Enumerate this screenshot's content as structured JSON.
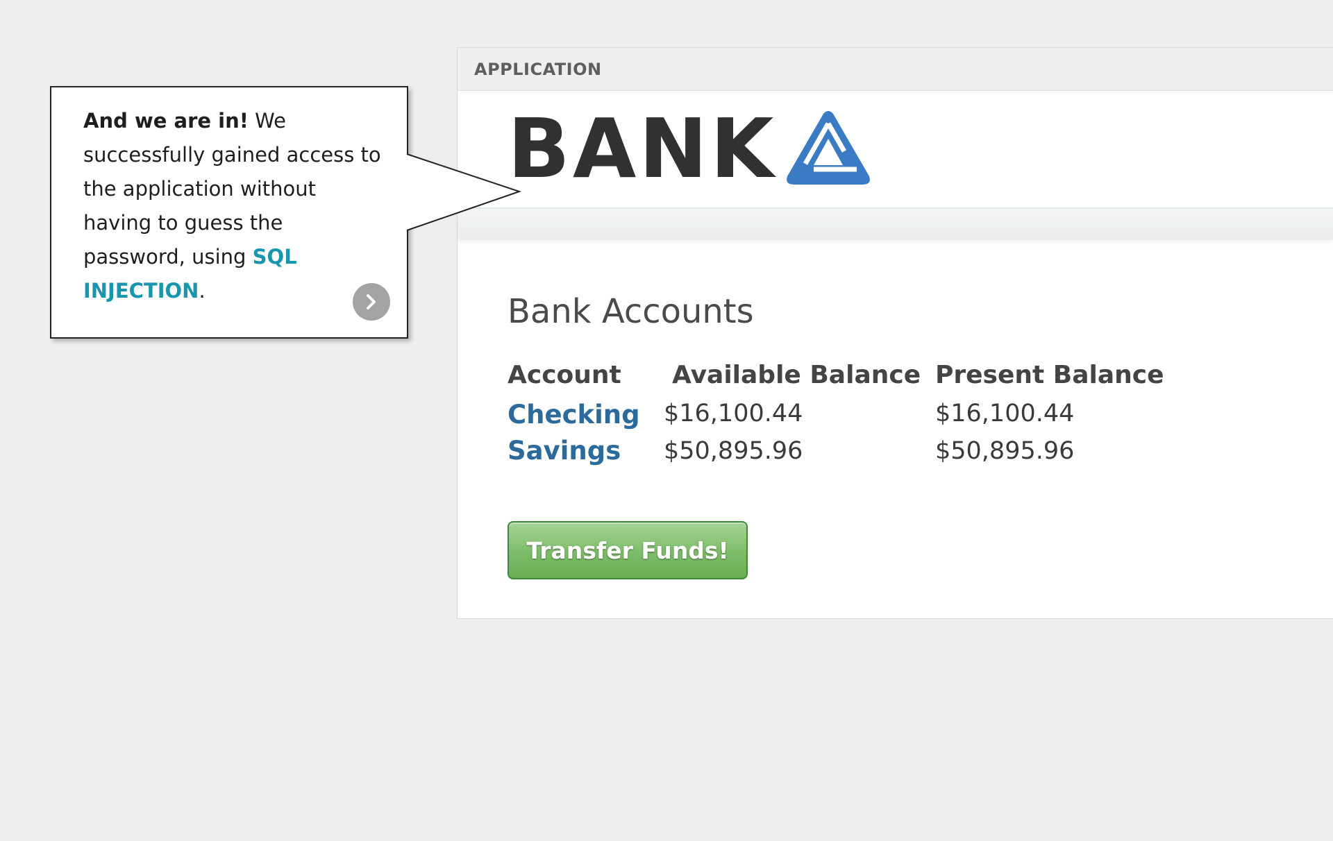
{
  "app": {
    "title": "APPLICATION",
    "logo_text": "BANK",
    "logo_icon": "blue-triangle-logo-icon"
  },
  "accounts": {
    "title": "Bank Accounts",
    "headers": {
      "account": "Account",
      "available": "Available Balance",
      "present": "Present Balance"
    },
    "rows": [
      {
        "name": "Checking",
        "available": "$16,100.44",
        "present": "$16,100.44"
      },
      {
        "name": "Savings",
        "available": "$50,895.96",
        "present": "$50,895.96"
      }
    ]
  },
  "transfer_button": {
    "label": "Transfer Funds!"
  },
  "callout": {
    "lead": "And we are in!",
    "body": " We successfully gained access to the application without having to guess the password, using ",
    "highlight": "SQL INJECTION",
    "tail": ".",
    "next_icon": "chevron-right-icon"
  },
  "colors": {
    "background": "#eeeeee",
    "link_blue": "#2c6a9c",
    "logo_blue": "#3b7bc4",
    "highlight_teal": "#1996ad",
    "button_green": "#7cbc68"
  }
}
